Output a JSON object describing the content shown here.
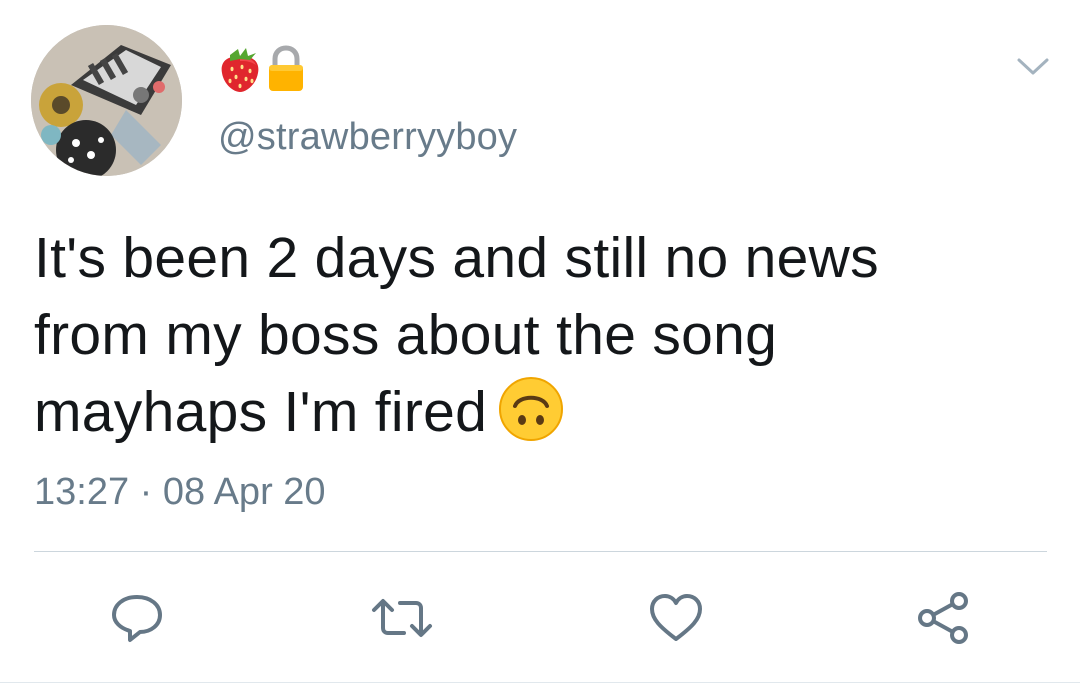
{
  "tweet": {
    "author": {
      "display_name_emojis": [
        "strawberry-emoji",
        "lock-emoji"
      ],
      "handle": "@strawberryyboy"
    },
    "text_lines": [
      "It's been 2 days and still no news",
      "from my boss about the song",
      "mayhaps I'm fired"
    ],
    "text_trailing_emoji": "upside-down-face-emoji",
    "timestamp": "13:27 · 08 Apr 20"
  },
  "actions": [
    {
      "name": "reply",
      "icon": "reply-icon"
    },
    {
      "name": "retweet",
      "icon": "retweet-icon"
    },
    {
      "name": "like",
      "icon": "heart-icon"
    },
    {
      "name": "share",
      "icon": "share-icon"
    }
  ],
  "colors": {
    "text": "#14171a",
    "secondary": "#687b8a",
    "icon": "#657786",
    "divider": "#ccd6dd"
  }
}
